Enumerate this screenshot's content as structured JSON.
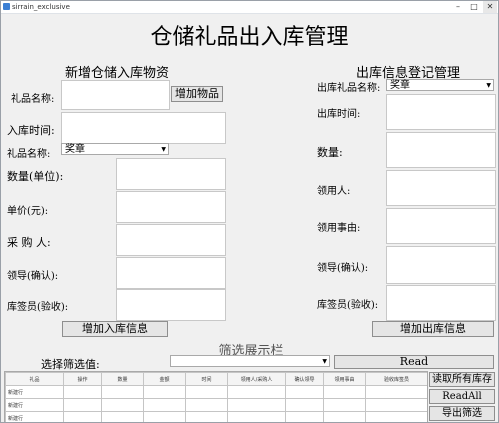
{
  "window": {
    "title": "sirrain_exclusive",
    "minimize": "–",
    "maximize": "□",
    "close": "✕"
  },
  "main_title": "仓储礼品出入库管理",
  "inbound": {
    "section_title": "新增仓储入库物资",
    "gift_name_label": "礼品名称:",
    "add_item_button": "增加物品",
    "in_time_label": "入库时间:",
    "gift_name_select_label": "礼品名称:",
    "gift_name_selected": "奖章",
    "quantity_label": "数量(单位):",
    "unit_price_label": "单价(元):",
    "purchaser_label": "采 购 人:",
    "leader_label": "领导(确认):",
    "keeper_label": "库签员(验收):",
    "submit_button": "增加入库信息"
  },
  "outbound": {
    "section_title": "出库信息登记管理",
    "gift_name_label": "出库礼品名称:",
    "gift_name_selected": "奖章",
    "out_time_label": "出库时间:",
    "quantity_label": "数量:",
    "recipient_label": "领用人:",
    "reason_label": "领用事由:",
    "leader_label": "领导(确认):",
    "keeper_label": "库签员(验收):",
    "submit_button": "增加出库信息"
  },
  "filter": {
    "section_title": "筛选展示栏",
    "select_label": "选择筛选值:",
    "selected_value": "",
    "read_button": "Read",
    "read_all_stock_button": "读取所有库存",
    "read_all_button": "ReadAll",
    "export_button": "导出筛选"
  },
  "table": {
    "columns": [
      "礼品",
      "操作",
      "数量",
      "金额",
      "时间",
      "领用人/采购人",
      "确认领导",
      "领用事由",
      "验收库签员"
    ],
    "rows": [
      [
        "新建行",
        "",
        "",
        "",
        "",
        "",
        "",
        "",
        ""
      ],
      [
        "新建行",
        "",
        "",
        "",
        "",
        "",
        "",
        "",
        ""
      ],
      [
        "新建行",
        "",
        "",
        "",
        "",
        "",
        "",
        "",
        ""
      ]
    ]
  }
}
